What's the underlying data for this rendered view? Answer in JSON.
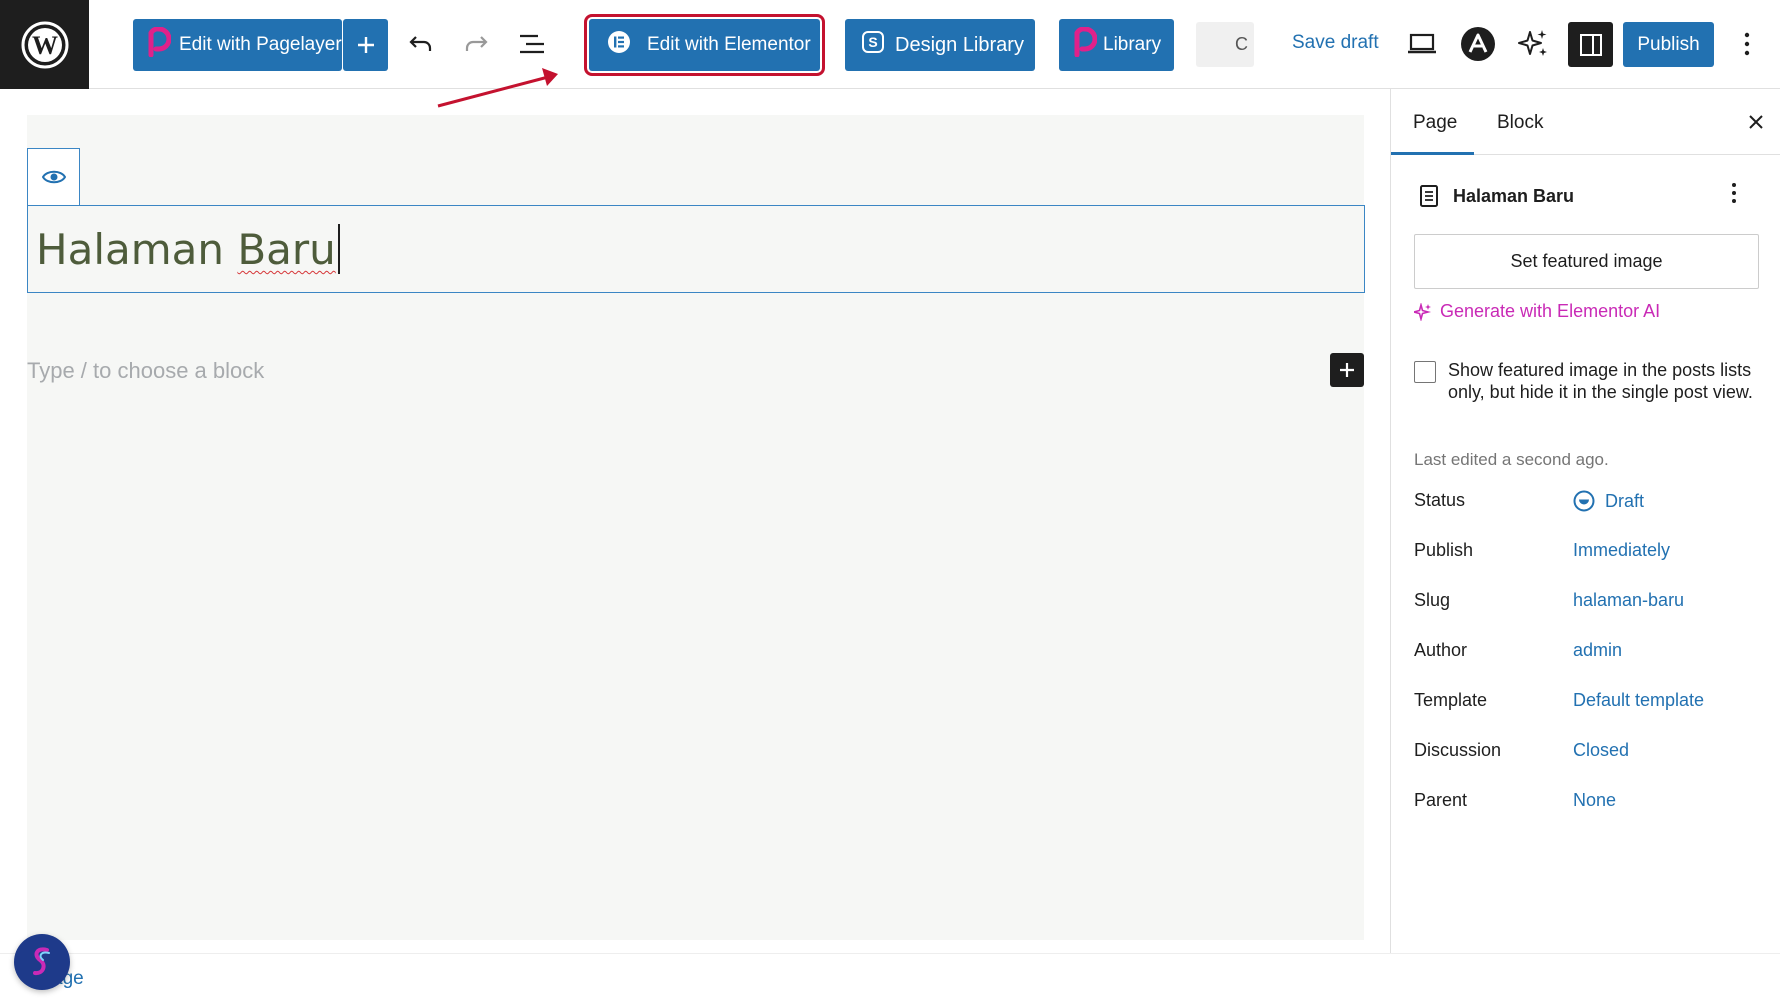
{
  "toolbar": {
    "pagelayer_label": "Edit with Pagelayer",
    "elementor_label": "Edit with Elementor",
    "design_library_label": "Design Library",
    "library_label": "Library",
    "grey_btn_text": "C",
    "save_draft_label": "Save draft",
    "publish_label": "Publish"
  },
  "editor": {
    "title_prefix": "Halaman ",
    "title_misspelled": "Baru",
    "block_placeholder": "Type / to choose a block"
  },
  "sidebar": {
    "tabs": [
      {
        "label": "Page",
        "active": true
      },
      {
        "label": "Block",
        "active": false
      }
    ],
    "document_title": "Halaman Baru",
    "featured_image_label": "Set featured image",
    "generate_ai_label": "Generate with Elementor AI",
    "featured_checkbox_label": "Show featured image in the posts lists only, but hide it in the single post view.",
    "featured_checkbox_checked": false,
    "last_edited": "Last edited a second ago.",
    "meta": [
      {
        "label": "Status",
        "value": "Draft"
      },
      {
        "label": "Publish",
        "value": "Immediately"
      },
      {
        "label": "Slug",
        "value": "halaman-baru"
      },
      {
        "label": "Author",
        "value": "admin"
      },
      {
        "label": "Template",
        "value": "Default template"
      },
      {
        "label": "Discussion",
        "value": "Closed"
      },
      {
        "label": "Parent",
        "value": "None"
      }
    ]
  },
  "footer": {
    "breadcrumb_fragment": "age"
  },
  "colors": {
    "accent": "#2271b1",
    "highlight_outline": "#c4122f",
    "ai_magenta": "#c92ab6",
    "pagelayer_pink": "#e0218a",
    "dark": "#1e1e1e"
  },
  "icons": {
    "wordpress": "wordpress-logo-icon",
    "undo": "undo-icon",
    "redo": "redo-icon",
    "list_view": "list-view-icon",
    "preview": "desktop-preview-icon",
    "astra": "astra-icon",
    "sparkles": "sparkles-icon",
    "sidebar": "sidebar-toggle-icon",
    "more": "more-vertical-icon"
  }
}
